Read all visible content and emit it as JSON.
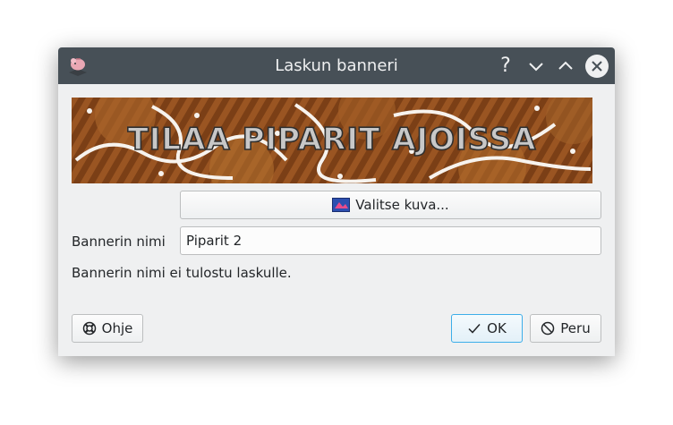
{
  "window": {
    "title": "Laskun banneri",
    "help_symbol": "?"
  },
  "banner": {
    "text": "TILAA PIPARIT AJOISSA"
  },
  "choose_image_button": {
    "label": "Valitse kuva..."
  },
  "banner_name": {
    "label": "Bannerin nimi",
    "value": "Piparit 2"
  },
  "note": "Bannerin nimi ei tulostu laskulle.",
  "buttons": {
    "help": "Ohje",
    "ok": "OK",
    "cancel": "Peru"
  },
  "colors": {
    "titlebar": "#475057",
    "dialog_bg": "#eff0f1",
    "focus_accent": "#3daee9"
  },
  "icons": {
    "app": "piggy-bank-icon",
    "help": "question-mark-icon",
    "minimize": "chevron-down-icon",
    "maximize": "chevron-up-icon",
    "close": "close-icon",
    "choose_image": "image-icon",
    "help_button": "lifebuoy-icon",
    "ok": "checkmark-icon",
    "cancel": "cancel-icon"
  }
}
